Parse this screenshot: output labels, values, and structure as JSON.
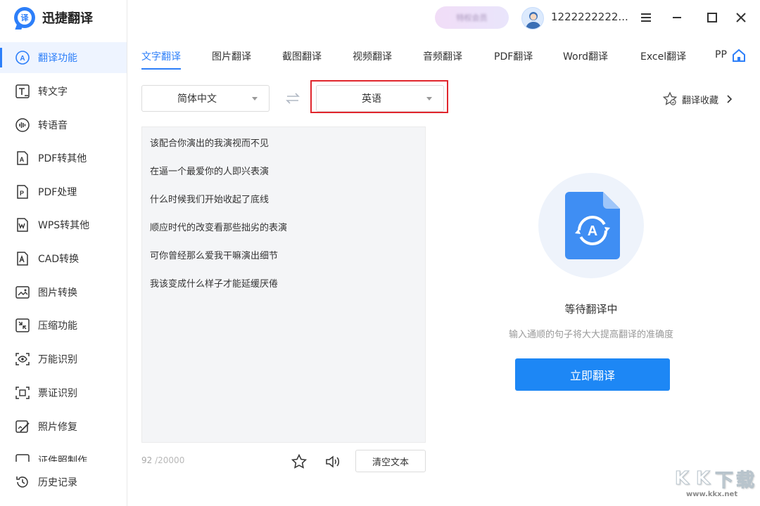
{
  "app": {
    "name": "迅捷翻译",
    "logo_glyph": "译",
    "accent": "#2d7ff9"
  },
  "topbar": {
    "vip_text": "特权会员",
    "username": "1222222222..."
  },
  "sidebar": {
    "items": [
      {
        "label": "翻译功能",
        "icon": "translate-icon",
        "active": true
      },
      {
        "label": "转文字",
        "icon": "to-text-icon"
      },
      {
        "label": "转语音",
        "icon": "to-speech-icon"
      },
      {
        "label": "PDF转其他",
        "icon": "pdf-convert-icon"
      },
      {
        "label": "PDF处理",
        "icon": "pdf-process-icon"
      },
      {
        "label": "WPS转其他",
        "icon": "wps-convert-icon"
      },
      {
        "label": "CAD转换",
        "icon": "cad-convert-icon"
      },
      {
        "label": "图片转换",
        "icon": "image-convert-icon"
      },
      {
        "label": "压缩功能",
        "icon": "compress-icon"
      },
      {
        "label": "万能识别",
        "icon": "eye-scan-icon"
      },
      {
        "label": "票证识别",
        "icon": "ticket-scan-icon"
      },
      {
        "label": "照片修复",
        "icon": "photo-repair-icon"
      },
      {
        "label": "证件照制作",
        "icon": "id-photo-icon"
      },
      {
        "label": "历史记录",
        "icon": "history-icon"
      }
    ]
  },
  "tabs": [
    {
      "label": "文字翻译",
      "active": true
    },
    {
      "label": "图片翻译"
    },
    {
      "label": "截图翻译"
    },
    {
      "label": "视频翻译"
    },
    {
      "label": "音频翻译"
    },
    {
      "label": "PDF翻译"
    },
    {
      "label": "Word翻译"
    },
    {
      "label": "Excel翻译"
    },
    {
      "label": "PP"
    }
  ],
  "languages": {
    "source": "简体中文",
    "target": "英语"
  },
  "favorites_label": "翻译收藏",
  "source_text": [
    "该配合你演出的我演视而不见",
    "在逼一个最爱你的人即兴表演",
    "什么时候我们开始收起了底线",
    "顺应时代的改变看那些拙劣的表演",
    "可你曾经那么爱我干嘛演出细节",
    "我该变成什么样子才能延缓厌倦"
  ],
  "counter": {
    "current": "92",
    "max": "/20000"
  },
  "clear_label": "清空文本",
  "result": {
    "title": "等待翻译中",
    "hint": "输入通顺的句子将大大提高翻译的准确度",
    "translate_button": "立即翻译"
  },
  "watermark": {
    "letters": [
      "K",
      "K",
      "下",
      "载"
    ],
    "url": "www.kkx.net"
  }
}
